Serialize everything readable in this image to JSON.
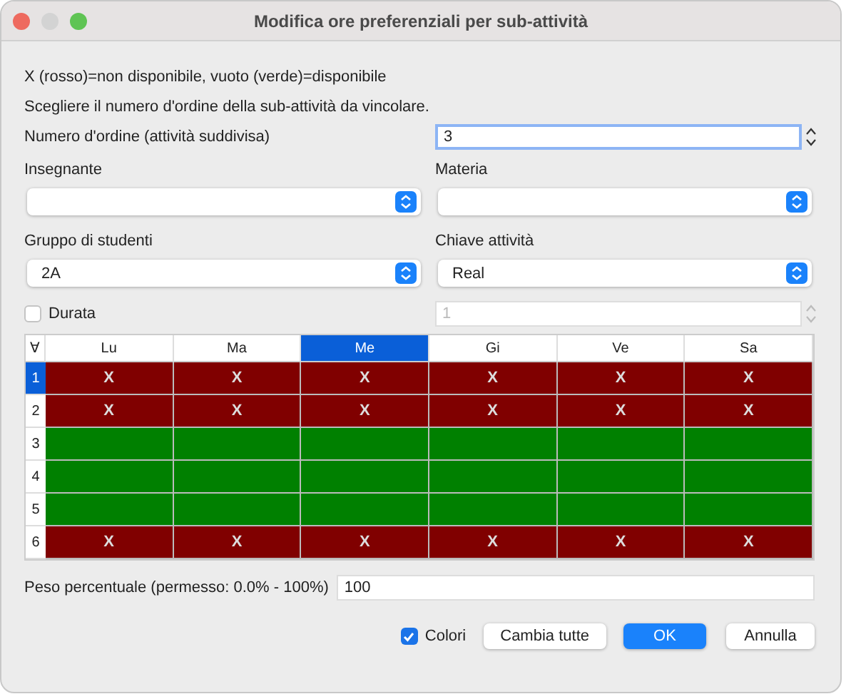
{
  "window": {
    "title": "Modifica ore preferenziali per sub-attività"
  },
  "legend": "X (rosso)=non disponibile, vuoto (verde)=disponibile",
  "instruction": "Scegliere il numero d'ordine della sub-attività da vincolare.",
  "order_number": {
    "label": "Numero d'ordine (attività suddivisa)",
    "value": "3"
  },
  "selects": [
    {
      "label": "Insegnante"
    },
    {
      "label": "Materia"
    },
    {
      "label": "Gruppo di studenti",
      "value": "2A"
    },
    {
      "label": "Chiave attività",
      "value": "Real"
    }
  ],
  "duration": {
    "label": "Durata",
    "checked": false,
    "value": "1",
    "disabled": true
  },
  "grid": {
    "corner": "∀",
    "columns": [
      {
        "label": "Lu",
        "selected": false
      },
      {
        "label": "Ma",
        "selected": false
      },
      {
        "label": "Me",
        "selected": true
      },
      {
        "label": "Gi",
        "selected": false
      },
      {
        "label": "Ve",
        "selected": false
      },
      {
        "label": "Sa",
        "selected": false
      }
    ],
    "rows": [
      {
        "label": "1",
        "selected": true,
        "cells": [
          {
            "text": "X",
            "available": false
          },
          {
            "text": "X",
            "available": false
          },
          {
            "text": "X",
            "available": false
          },
          {
            "text": "X",
            "available": false
          },
          {
            "text": "X",
            "available": false
          },
          {
            "text": "X",
            "available": false
          }
        ]
      },
      {
        "label": "2",
        "selected": false,
        "cells": [
          {
            "text": "X",
            "available": false
          },
          {
            "text": "X",
            "available": false
          },
          {
            "text": "X",
            "available": false
          },
          {
            "text": "X",
            "available": false
          },
          {
            "text": "X",
            "available": false
          },
          {
            "text": "X",
            "available": false
          }
        ]
      },
      {
        "label": "3",
        "selected": false,
        "cells": [
          {
            "available": true
          },
          {
            "available": true
          },
          {
            "available": true
          },
          {
            "available": true
          },
          {
            "available": true
          },
          {
            "available": true
          }
        ]
      },
      {
        "label": "4",
        "selected": false,
        "cells": [
          {
            "available": true
          },
          {
            "available": true
          },
          {
            "available": true
          },
          {
            "available": true
          },
          {
            "available": true
          },
          {
            "available": true
          }
        ]
      },
      {
        "label": "5",
        "selected": false,
        "cells": [
          {
            "available": true
          },
          {
            "available": true
          },
          {
            "available": true
          },
          {
            "available": true
          },
          {
            "available": true
          },
          {
            "available": true
          }
        ]
      },
      {
        "label": "6",
        "selected": false,
        "cells": [
          {
            "text": "X",
            "available": false
          },
          {
            "text": "X",
            "available": false
          },
          {
            "text": "X",
            "available": false
          },
          {
            "text": "X",
            "available": false
          },
          {
            "text": "X",
            "available": false
          },
          {
            "text": "X",
            "available": false
          }
        ]
      }
    ]
  },
  "weight": {
    "label": "Peso percentuale (permesso: 0.0% - 100%)",
    "value": "100"
  },
  "colors_checkbox": {
    "label": "Colori",
    "checked": true
  },
  "buttons": [
    {
      "label": "Cambia tutte",
      "kind": "normal"
    },
    {
      "label": "OK",
      "kind": "default"
    },
    {
      "label": "Annulla",
      "kind": "normal"
    }
  ]
}
